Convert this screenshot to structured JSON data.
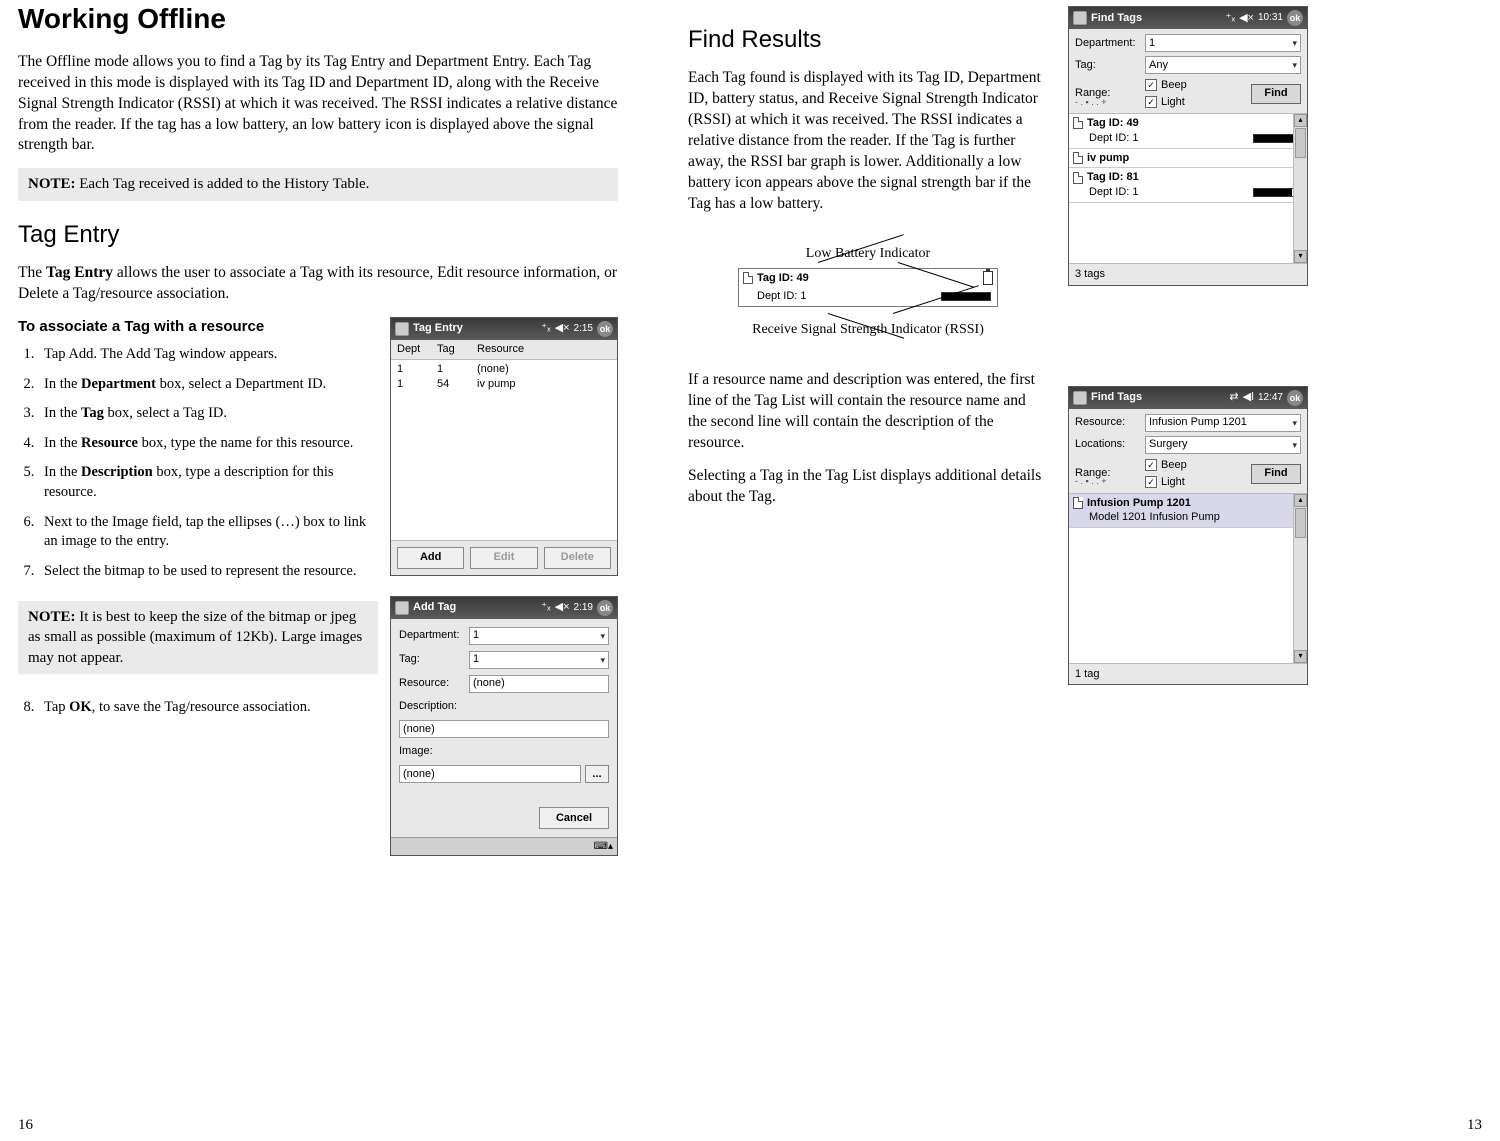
{
  "left": {
    "h1": "Working Offline",
    "p1": "The Offline mode allows you to find a Tag by its Tag Entry and Department Entry. Each Tag received in this mode is displayed with its Tag ID and Department ID, along with the Receive Signal Strength Indicator (RSSI) at which it was received. The RSSI indicates a relative distance from the reader. If the tag has a low battery, an low battery icon is displayed above the signal strength bar.",
    "note1_label": "NOTE:",
    "note1_text": "  Each Tag received is added to the History Table.",
    "h2": "Tag Entry",
    "p2_a": "The ",
    "p2_b": "Tag Entry",
    "p2_c": " allows the user to associate a Tag with its resource, Edit resource information, or Delete a Tag/resource association.",
    "subhead": "To associate a Tag with a resource",
    "steps": [
      "Tap Add. The Add Tag window appears.",
      "In the Department box, select a Department ID.",
      "In the Tag box, select a Tag ID.",
      "In the Resource box, type the name for this resource.",
      "In the Description box, type a description for this resource.",
      "Next to the Image field, tap the ellipses (…) box to link an image to the entry.",
      "Select the bitmap to be used to represent the resource."
    ],
    "step_bolds": [
      "",
      "Department",
      "Tag",
      "Resource",
      "Description",
      "",
      ""
    ],
    "note2_label": "NOTE:",
    "note2_text": " It is best to keep the size of the bitmap or jpeg as small as possible (maximum of 12Kb). Large images may not appear.",
    "step8_a": "Tap ",
    "step8_b": "OK",
    "step8_c": ", to save the Tag/resource association.",
    "pda_tagentry": {
      "title": "Tag Entry",
      "time": "2:15",
      "ok": "ok",
      "cols": [
        "Dept",
        "Tag",
        "Resource"
      ],
      "rows": [
        [
          "1",
          "1",
          "(none)"
        ],
        [
          "1",
          "54",
          "iv pump"
        ]
      ],
      "btn_add": "Add",
      "btn_edit": "Edit",
      "btn_delete": "Delete"
    },
    "pda_addtag": {
      "title": "Add Tag",
      "time": "2:19",
      "ok": "ok",
      "labels": {
        "dept": "Department:",
        "tag": "Tag:",
        "resource": "Resource:",
        "desc": "Description:",
        "image": "Image:"
      },
      "vals": {
        "dept": "1",
        "tag": "1",
        "resource": "(none)",
        "desc": "(none)",
        "image": "(none)"
      },
      "ellipsis": "...",
      "cancel": "Cancel"
    },
    "pagenum": "16"
  },
  "right": {
    "h2": "Find Results",
    "p1": "Each Tag found is displayed with its Tag ID, Department ID, battery status, and Receive Signal Strength Indicator (RSSI) at which it was received. The RSSI indicates a relative distance from the reader. If the Tag is further away, the RSSI bar graph is lower. Additionally a low battery icon appears above the signal strength bar if the Tag has a low battery.",
    "callout_top": "Low Battery Indicator",
    "callout_tagid": "Tag ID: 49",
    "callout_dept": "Dept ID: 1",
    "callout_bottom": "Receive Signal Strength Indicator (RSSI)",
    "p2": "If a resource name and description was entered, the first line of the Tag List will contain the resource name and the second line will contain the description of the resource.",
    "p3": "Selecting a Tag in the Tag List displays additional details about the Tag.",
    "pda_find1": {
      "title": "Find Tags",
      "time": "10:31",
      "ok": "ok",
      "labels": {
        "dept": "Department:",
        "tag": "Tag:",
        "range": "Range:",
        "beep": "Beep",
        "light": "Light",
        "find": "Find"
      },
      "vals": {
        "dept": "1",
        "tag": "Any"
      },
      "items": [
        {
          "l1": "Tag ID: 49",
          "l2": "Dept ID: 1",
          "rssi": 100
        },
        {
          "l1": "iv pump",
          "l2": "",
          "rssi": null,
          "icon": true
        },
        {
          "l1": "Tag ID: 81",
          "l2": "Dept ID: 1",
          "rssi": 80
        }
      ],
      "footer": "3 tags"
    },
    "pda_find2": {
      "title": "Find Tags",
      "time": "12:47",
      "ok": "ok",
      "labels": {
        "resource": "Resource:",
        "locations": "Locations:",
        "range": "Range:",
        "beep": "Beep",
        "light": "Light",
        "find": "Find"
      },
      "vals": {
        "resource": "Infusion Pump 1201",
        "locations": "Surgery"
      },
      "items": [
        {
          "l1": "Infusion Pump 1201",
          "l2": "Model 1201 Infusion Pump",
          "batt": true
        }
      ],
      "footer": "1 tag"
    },
    "pagenum": "13"
  }
}
